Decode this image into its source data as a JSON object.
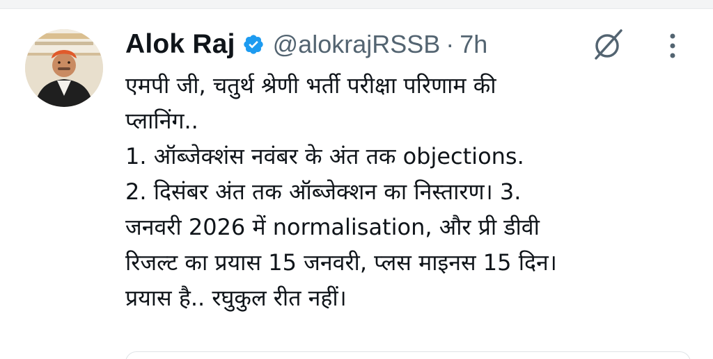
{
  "tweet": {
    "author": {
      "display_name": "Alok Raj",
      "verified": true,
      "verified_color": "#1d9bf0",
      "handle": "@alokrajRSSB",
      "separator": "·",
      "timestamp": "7h"
    },
    "icons": {
      "grok": "grok-icon",
      "more": "more-options-icon",
      "verified": "verified-badge-icon"
    },
    "text_lines": [
      "एमपी जी, चतुर्थ श्रेणी भर्ती परीक्षा परिणाम की",
      "प्लानिंग..",
      "1. ऑब्जेक्शंस नवंबर के अंत तक objections.",
      "2. दिसंबर अंत तक ऑब्जेक्शन का निस्तारण। 3.",
      "जनवरी 2026 में normalisation, और प्री डीवी",
      "रिजल्ट का प्रयास 15 जनवरी, प्लस माइनस 15 दिन।",
      "प्रयास है.. रघुकुल रीत नहीं।"
    ]
  }
}
